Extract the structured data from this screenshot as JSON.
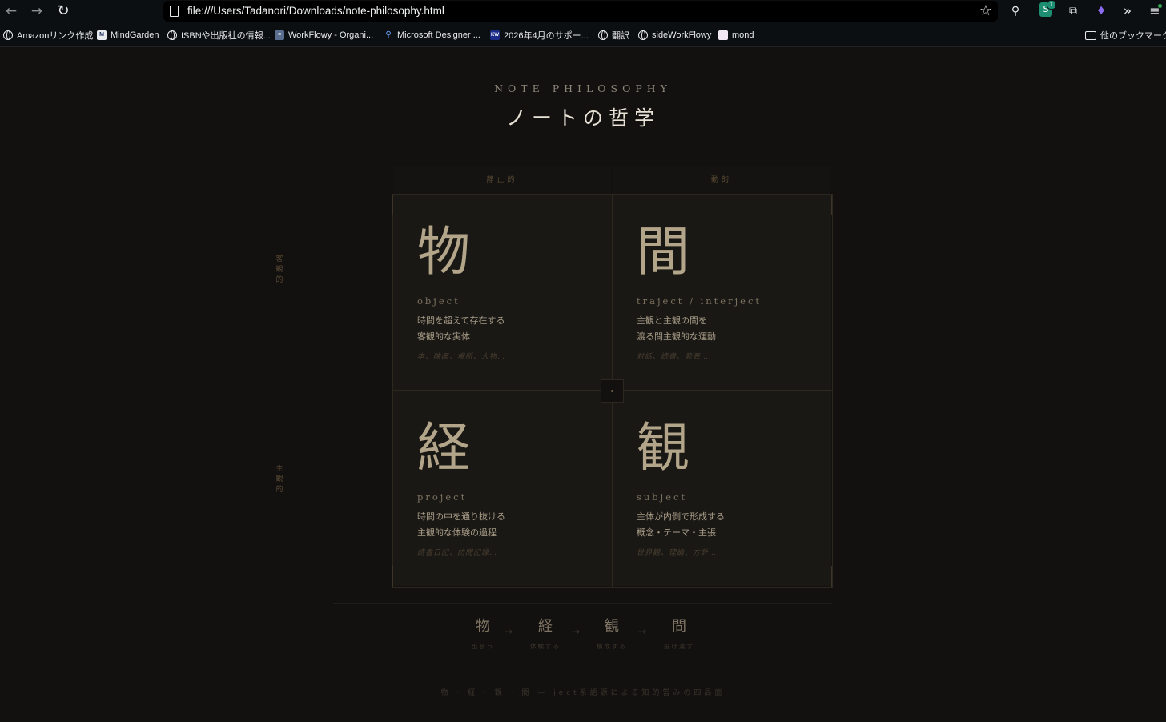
{
  "browser": {
    "url": "file:///Users/Tadanori/Downloads/note-philosophy.html",
    "extension_badge_count": "1",
    "bookmarks": [
      {
        "label": "Amazonリンク作成",
        "icon": "globe-icon"
      },
      {
        "label": "MindGarden",
        "icon": "mindgarden-icon"
      },
      {
        "label": "ISBNや出版社の情報...",
        "icon": "globe-icon"
      },
      {
        "label": "WorkFlowy - Organi...",
        "icon": "workflowy-icon"
      },
      {
        "label": "Microsoft Designer ...",
        "icon": "search-icon"
      },
      {
        "label": "2026年4月のサポー...",
        "icon": "kw-icon"
      },
      {
        "label": "翻訳",
        "icon": "globe-icon"
      },
      {
        "label": "sideWorkFlowy",
        "icon": "globe-icon"
      },
      {
        "label": "mond",
        "icon": "mond-icon"
      }
    ],
    "other_bookmarks": "他のブックマーク"
  },
  "page": {
    "eyebrow": "NOTE PHILOSOPHY",
    "title": "ノートの哲学",
    "columns": [
      "静止的",
      "動的"
    ],
    "rows": [
      "客観的",
      "主観的"
    ],
    "cells": [
      {
        "kanji": "物",
        "en": "object",
        "desc1": "時間を超えて存在する",
        "desc2": "客観的な実体",
        "examples": "本、映画、場所、人物…"
      },
      {
        "kanji": "間",
        "en": "traject / interject",
        "desc1": "主観と主観の間を",
        "desc2": "渡る間主観的な運動",
        "examples": "対話、読書、発表…"
      },
      {
        "kanji": "経",
        "en": "project",
        "desc1": "時間の中を通り抜ける",
        "desc2": "主観的な体験の過程",
        "examples": "読書日記、訪問記録…"
      },
      {
        "kanji": "観",
        "en": "subject",
        "desc1": "主体が内側で形成する",
        "desc2": "概念・テーマ・主張",
        "examples": "世界観、理論、方針…"
      }
    ],
    "flow": [
      {
        "kanji": "物",
        "label": "出会う"
      },
      {
        "kanji": "経",
        "label": "体験する"
      },
      {
        "kanji": "観",
        "label": "構成する"
      },
      {
        "kanji": "間",
        "label": "投げ渡す"
      }
    ],
    "flow_arrow": "→",
    "footer": "物 · 経 · 観 · 間 — ject系語源による知的営みの四局面"
  }
}
